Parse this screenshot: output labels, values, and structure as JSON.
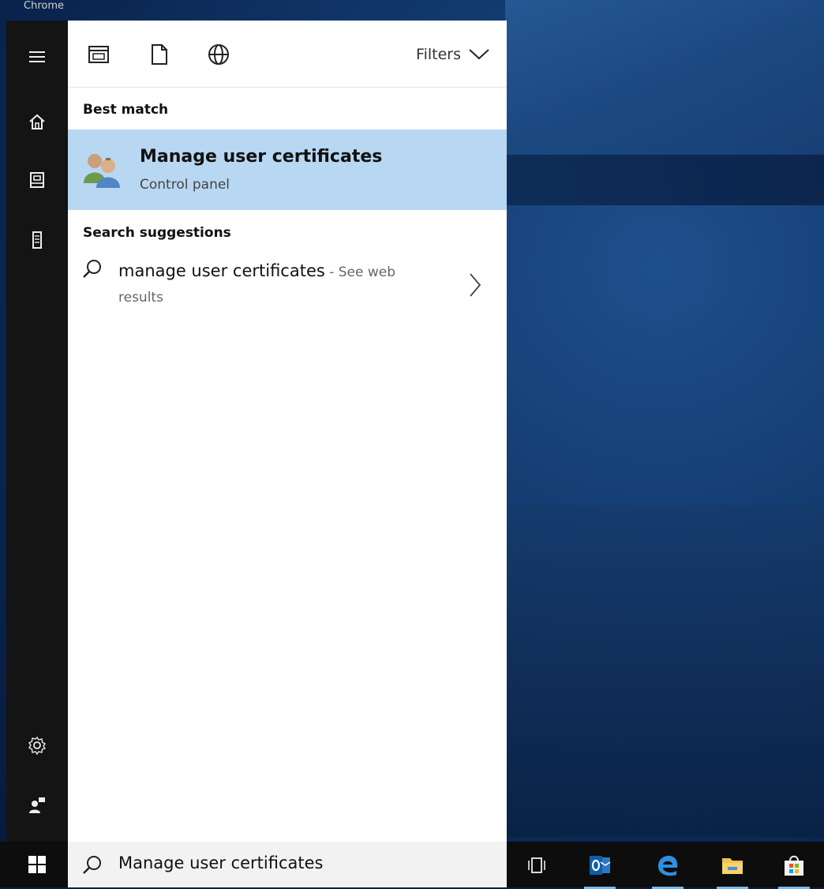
{
  "desktop": {
    "top_caption": "Chrome"
  },
  "rail": {
    "items": [
      {
        "name": "menu-icon"
      },
      {
        "name": "home-icon"
      },
      {
        "name": "notebook-icon"
      },
      {
        "name": "device-icon"
      },
      {
        "name": "settings-icon"
      },
      {
        "name": "feedback-icon"
      }
    ]
  },
  "filter_bar": {
    "icons": [
      "apps-filter-icon",
      "documents-filter-icon",
      "web-filter-icon"
    ],
    "filters_label": "Filters"
  },
  "results": {
    "best_match_heading": "Best match",
    "best_match": {
      "title": "Manage user certificates",
      "subtitle": "Control panel",
      "icon": "users-certificate-icon"
    },
    "suggestions_heading": "Search suggestions",
    "suggestion": {
      "query": "manage user certificates",
      "suffix": " - See web",
      "suffix_cont": "results"
    }
  },
  "taskbar": {
    "search_text": "Manage user certificates",
    "apps": [
      {
        "name": "task-view-icon"
      },
      {
        "name": "outlook-icon"
      },
      {
        "name": "edge-icon"
      },
      {
        "name": "file-explorer-icon"
      },
      {
        "name": "store-icon"
      }
    ]
  },
  "colors": {
    "highlight": "#b8d7f2",
    "rail": "#141414",
    "taskbar": "#0d0d0d"
  }
}
